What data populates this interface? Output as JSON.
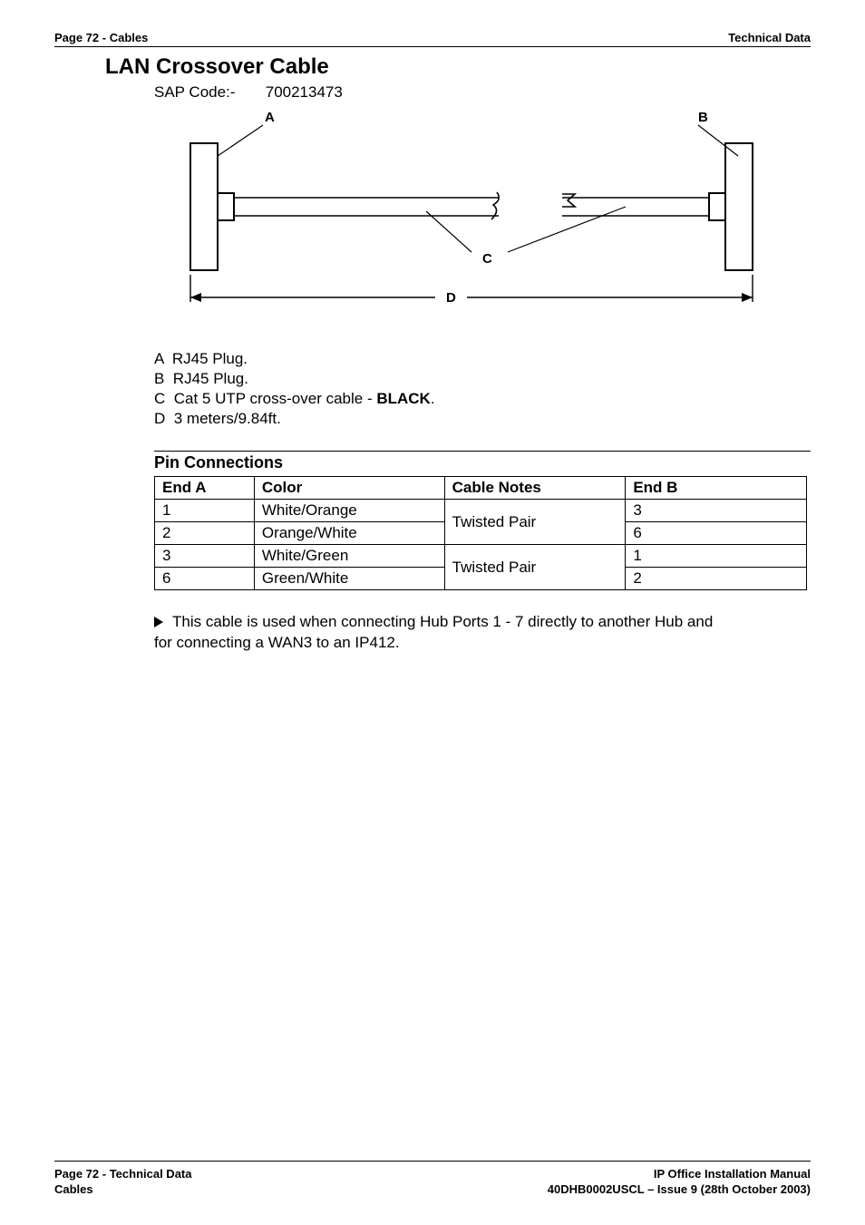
{
  "header": {
    "left": "Page 72 - Cables",
    "right": "Technical Data"
  },
  "title": "LAN Crossover Cable",
  "sap": {
    "label": "SAP Code:-",
    "value": "700213473"
  },
  "diagram_labels": {
    "a": "A",
    "b": "B",
    "c": "C",
    "d": "D"
  },
  "legend": {
    "a_prefix": "A  ",
    "a_text": "RJ45 Plug.",
    "b_prefix": "B  ",
    "b_text": "RJ45 Plug.",
    "c_prefix": "C  ",
    "c_text_pre": "Cat 5 UTP cross-over cable - ",
    "c_text_bold": "BLACK",
    "c_text_post": ".",
    "d_prefix": "D  ",
    "d_text": "3 meters/9.84ft."
  },
  "pin_section_title": "Pin Connections",
  "pin_headers": {
    "end_a": "End A",
    "color": "Color",
    "notes": "Cable Notes",
    "end_b": "End B"
  },
  "pin_rows": [
    {
      "a": "1",
      "color": "White/Orange",
      "b": "3"
    },
    {
      "a": "2",
      "color": "Orange/White",
      "b": "6"
    },
    {
      "a": "3",
      "color": "White/Green",
      "b": "1"
    },
    {
      "a": "6",
      "color": "Green/White",
      "b": "2"
    }
  ],
  "pin_group_notes": [
    "Twisted Pair",
    "Twisted Pair"
  ],
  "note_text": "This cable is used when connecting Hub Ports 1 - 7 directly to another Hub and for connecting a WAN3 to an IP412.",
  "chart_data": {
    "type": "table",
    "title": "Pin Connections",
    "columns": [
      "End A",
      "Color",
      "Cable Notes",
      "End B"
    ],
    "rows": [
      [
        "1",
        "White/Orange",
        "Twisted Pair",
        "3"
      ],
      [
        "2",
        "Orange/White",
        "Twisted Pair",
        "6"
      ],
      [
        "3",
        "White/Green",
        "Twisted Pair",
        "1"
      ],
      [
        "6",
        "Green/White",
        "Twisted Pair",
        "2"
      ]
    ]
  },
  "footer": {
    "left_line1": "Page 72 - Technical Data",
    "left_line2": "Cables",
    "right_line1": "IP Office Installation Manual",
    "right_line2": "40DHB0002USCL – Issue 9 (28th October 2003)"
  }
}
